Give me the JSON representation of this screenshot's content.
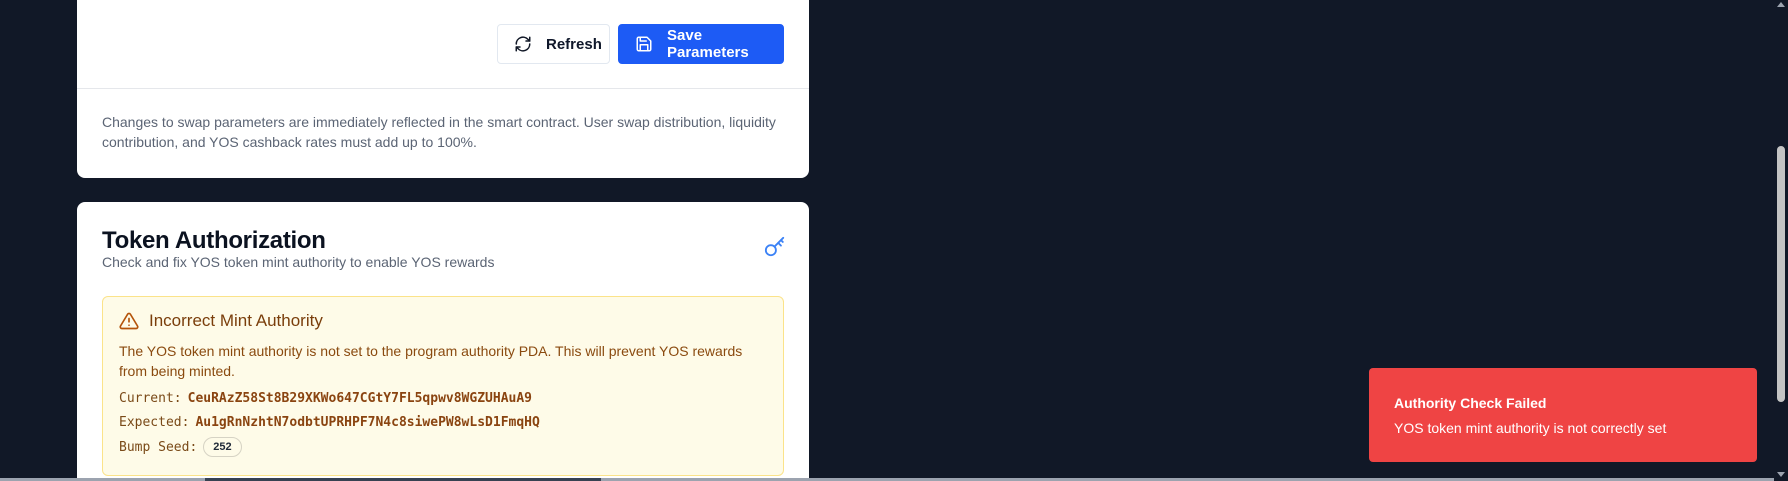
{
  "toolbar": {
    "refresh_label": "Refresh",
    "save_label": "Save Parameters"
  },
  "parameters": {
    "note": "Changes to swap parameters are immediately reflected in the smart contract. User swap distribution, liquidity contribution, and YOS cashback rates must add up to 100%."
  },
  "token_authorization": {
    "title": "Token Authorization",
    "subtitle": "Check and fix YOS token mint authority to enable YOS rewards",
    "alert": {
      "title": "Incorrect Mint Authority",
      "message": "The YOS token mint authority is not set to the program authority PDA. This will prevent YOS rewards from being minted.",
      "current_label": "Current:",
      "current_value": "CeuRAzZ58St8B29XKWo647CGtY7FL5qpwv8WGZUHAuA9",
      "expected_label": "Expected:",
      "expected_value": "Au1gRnNzhtN7odbtUPRHPF7N4c8siwePW8wLsD1FmqHQ",
      "bump_label": "Bump Seed:",
      "bump_value": "252"
    }
  },
  "toast": {
    "title": "Authority Check Failed",
    "message": "YOS token mint authority is not correctly set"
  },
  "colors": {
    "page_background": "#111827",
    "primary_button": "#1d5bf5",
    "alert_background": "#fefbe8",
    "alert_border": "#fbe38a",
    "alert_text": "#8a4a0f",
    "toast_background": "#ef4444",
    "key_icon": "#3b82f6"
  },
  "icons": {
    "refresh": "refresh-icon",
    "save": "save-icon",
    "key": "key-icon",
    "warning": "warning-icon"
  }
}
